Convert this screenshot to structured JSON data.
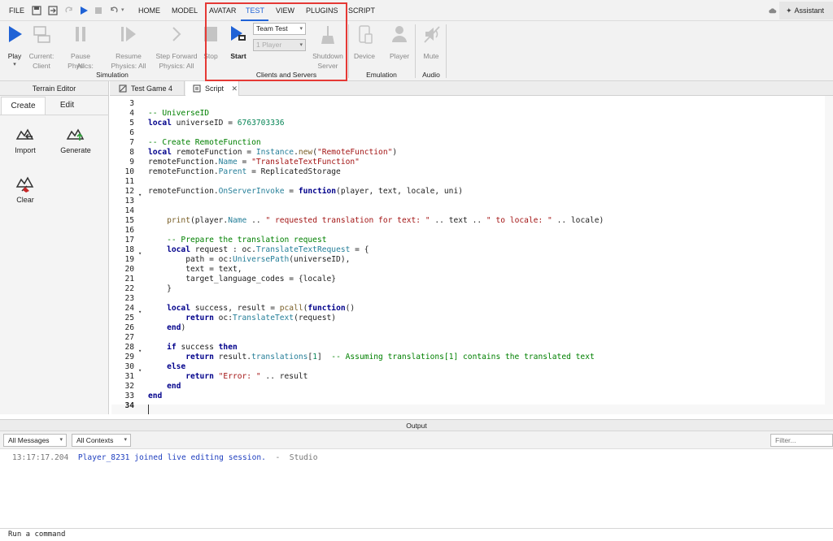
{
  "menubar": {
    "file": "FILE",
    "tabs": [
      "HOME",
      "MODEL",
      "AVATAR",
      "TEST",
      "VIEW",
      "PLUGINS",
      "SCRIPT"
    ],
    "active_tab": "TEST",
    "assistant": "Assistant"
  },
  "ribbon": {
    "play": "Play",
    "current_client": [
      "Current:",
      "Client"
    ],
    "pause_physics": [
      "Pause Physics:",
      "All"
    ],
    "resume_physics": [
      "Resume",
      "Physics: All"
    ],
    "step_forward": [
      "Step Forward",
      "Physics: All"
    ],
    "stop": "Stop",
    "simulation_label": "Simulation",
    "start": "Start",
    "team_test": "Team Test",
    "players": "1 Player",
    "shutdown_server": [
      "Shutdown",
      "Server"
    ],
    "clients_servers_label": "Clients and Servers",
    "device": "Device",
    "player": "Player",
    "emulation_label": "Emulation",
    "mute": "Mute",
    "audio_label": "Audio"
  },
  "terrain": {
    "title": "Terrain Editor",
    "tabs": [
      "Create",
      "Edit"
    ],
    "tools": [
      "Import",
      "Generate",
      "Clear"
    ]
  },
  "editor_tabs": [
    "Test Game 4",
    "Script"
  ],
  "code": {
    "line_numbers": [
      "3",
      "4",
      "5",
      "6",
      "7",
      "8",
      "9",
      "10",
      "11",
      "12",
      "13",
      "14",
      "15",
      "16",
      "17",
      "18",
      "19",
      "20",
      "21",
      "22",
      "23",
      "24",
      "25",
      "26",
      "27",
      "28",
      "29",
      "30",
      "31",
      "32",
      "33",
      "34"
    ]
  },
  "output": {
    "title": "Output",
    "filter_messages": "All Messages",
    "filter_contexts": "All Contexts",
    "filter_placeholder": "Filter...",
    "log_time": "13:17:17.204",
    "log_message": "Player_8231 joined live editing session.",
    "log_source": "-  Studio",
    "command_placeholder": "Run a command"
  },
  "colors": {
    "highlight_border": "#e53935",
    "play_blue": "#1f62d6",
    "keyword": "#00008b",
    "comment": "#008000",
    "string": "#a31515",
    "number": "#098658"
  }
}
